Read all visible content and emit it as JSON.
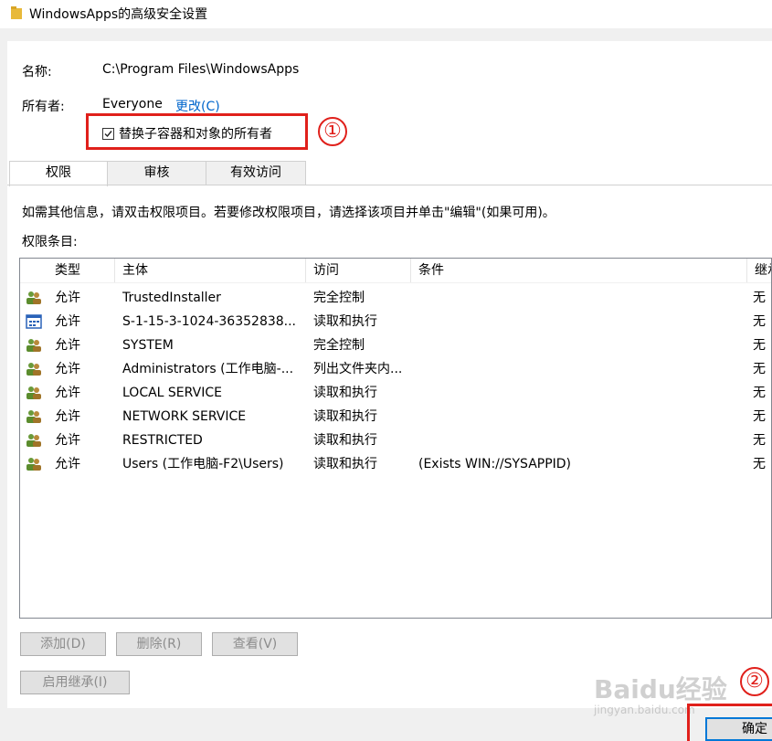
{
  "window": {
    "title": "WindowsApps的高级安全设置"
  },
  "name_label": "名称:",
  "name_value": "C:\\Program Files\\WindowsApps",
  "owner_label": "所有者:",
  "owner_value": "Everyone",
  "owner_change_link": "更改(C)",
  "replace_owner_checkbox": {
    "label": "替换子容器和对象的所有者",
    "checked": true
  },
  "annotations": {
    "one": "①",
    "two": "②",
    "color": "#e0201b"
  },
  "tabs": [
    {
      "label": "权限",
      "active": true
    },
    {
      "label": "审核",
      "active": false
    },
    {
      "label": "有效访问",
      "active": false
    }
  ],
  "info_text": "如需其他信息，请双击权限项目。若要修改权限项目，请选择该项目并单击\"编辑\"(如果可用)。",
  "entries_label": "权限条目:",
  "columns": [
    "类型",
    "主体",
    "访问",
    "条件",
    "继承"
  ],
  "rows": [
    {
      "icon": "users-icon",
      "type": "允许",
      "principal": "TrustedInstaller",
      "access": "完全控制",
      "condition": "",
      "inherit": "无"
    },
    {
      "icon": "app-package-icon",
      "type": "允许",
      "principal": "S-1-15-3-1024-36352838...",
      "access": "读取和执行",
      "condition": "",
      "inherit": "无"
    },
    {
      "icon": "users-icon",
      "type": "允许",
      "principal": "SYSTEM",
      "access": "完全控制",
      "condition": "",
      "inherit": "无"
    },
    {
      "icon": "users-icon",
      "type": "允许",
      "principal": "Administrators (工作电脑-...",
      "access": "列出文件夹内...",
      "condition": "",
      "inherit": "无"
    },
    {
      "icon": "users-icon",
      "type": "允许",
      "principal": "LOCAL SERVICE",
      "access": "读取和执行",
      "condition": "",
      "inherit": "无"
    },
    {
      "icon": "users-icon",
      "type": "允许",
      "principal": "NETWORK SERVICE",
      "access": "读取和执行",
      "condition": "",
      "inherit": "无"
    },
    {
      "icon": "users-icon",
      "type": "允许",
      "principal": "RESTRICTED",
      "access": "读取和执行",
      "condition": "",
      "inherit": "无"
    },
    {
      "icon": "users-icon",
      "type": "允许",
      "principal": "Users (工作电脑-F2\\Users)",
      "access": "读取和执行",
      "condition": "(Exists WIN://SYSAPPID)",
      "inherit": "无"
    }
  ],
  "buttons": {
    "add": "添加(D)",
    "remove": "删除(R)",
    "view": "查看(V)",
    "enable_inheritance": "启用继承(I)",
    "ok": "确定"
  },
  "watermark": {
    "main": "Baidu经验",
    "sub": "jingyan.baidu.com"
  }
}
